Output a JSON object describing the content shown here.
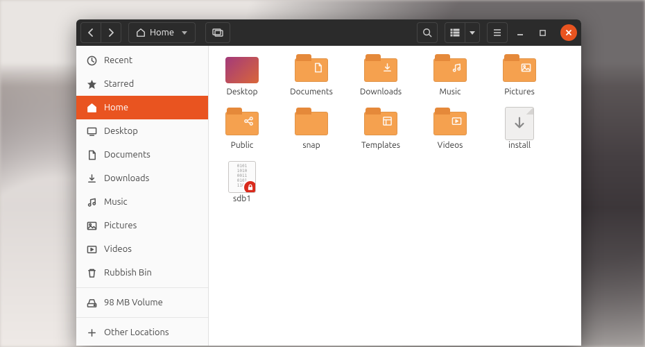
{
  "colors": {
    "accent": "#e95420",
    "folder": "#f5a14f"
  },
  "toolbar": {
    "path_label": "Home"
  },
  "sidebar": {
    "items": [
      {
        "id": "recent",
        "label": "Recent",
        "icon": "clock"
      },
      {
        "id": "starred",
        "label": "Starred",
        "icon": "star"
      },
      {
        "id": "home",
        "label": "Home",
        "icon": "home",
        "active": true
      },
      {
        "id": "desktop",
        "label": "Desktop",
        "icon": "desktop"
      },
      {
        "id": "documents",
        "label": "Documents",
        "icon": "documents"
      },
      {
        "id": "downloads",
        "label": "Downloads",
        "icon": "download"
      },
      {
        "id": "music",
        "label": "Music",
        "icon": "music"
      },
      {
        "id": "pictures",
        "label": "Pictures",
        "icon": "pictures"
      },
      {
        "id": "videos",
        "label": "Videos",
        "icon": "videos"
      },
      {
        "id": "trash",
        "label": "Rubbish Bin",
        "icon": "trash"
      },
      {
        "id": "volume",
        "label": "98 MB Volume",
        "icon": "drive"
      },
      {
        "id": "other",
        "label": "Other Locations",
        "icon": "plus"
      }
    ]
  },
  "files": [
    {
      "name": "Desktop",
      "kind": "desktop"
    },
    {
      "name": "Documents",
      "kind": "folder",
      "glyph": "documents"
    },
    {
      "name": "Downloads",
      "kind": "folder",
      "glyph": "download"
    },
    {
      "name": "Music",
      "kind": "folder",
      "glyph": "music"
    },
    {
      "name": "Pictures",
      "kind": "folder",
      "glyph": "pictures"
    },
    {
      "name": "Public",
      "kind": "folder",
      "glyph": "share"
    },
    {
      "name": "snap",
      "kind": "folder"
    },
    {
      "name": "Templates",
      "kind": "folder",
      "glyph": "templates"
    },
    {
      "name": "Videos",
      "kind": "folder",
      "glyph": "videos"
    },
    {
      "name": "install",
      "kind": "install"
    },
    {
      "name": "sdb1",
      "kind": "binlock"
    }
  ]
}
